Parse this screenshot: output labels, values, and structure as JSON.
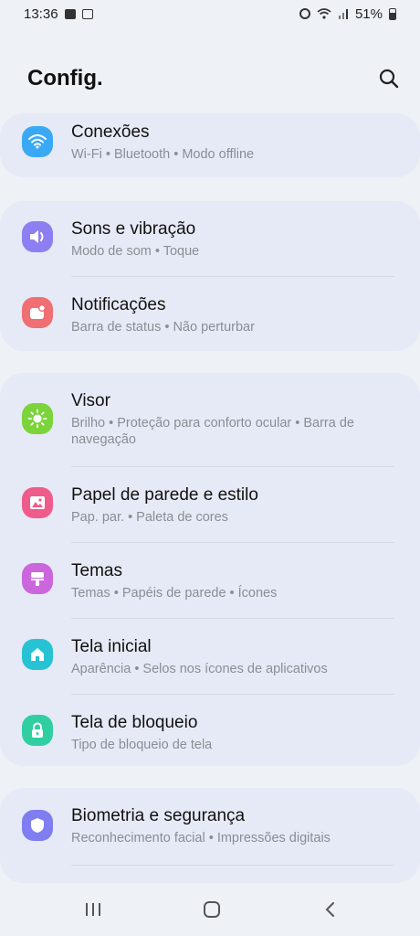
{
  "status_bar": {
    "time": "13:36",
    "battery_percent": "51%"
  },
  "header": {
    "title": "Config.",
    "search_icon": "search-icon"
  },
  "groups": [
    {
      "items": [
        {
          "id": "conexoes",
          "label": "Conexões",
          "subtitle": "Wi-Fi  •  Bluetooth  •  Modo offline",
          "icon": "wifi-icon",
          "color": "#3aa9f5"
        }
      ]
    },
    {
      "items": [
        {
          "id": "sons",
          "label": "Sons e vibração",
          "subtitle": "Modo de som  •  Toque",
          "icon": "speaker-icon",
          "color": "#8d7ff2"
        },
        {
          "id": "notificacoes",
          "label": "Notificações",
          "subtitle": "Barra de status  •  Não perturbar",
          "icon": "notification-icon",
          "color": "#ef6f73"
        }
      ]
    },
    {
      "items": [
        {
          "id": "visor",
          "label": "Visor",
          "subtitle": "Brilho  •  Proteção para conforto ocular  •  Barra de navegação",
          "icon": "sun-icon",
          "color": "#7ad43a"
        },
        {
          "id": "papel",
          "label": "Papel de parede e estilo",
          "subtitle": "Pap. par.  •  Paleta de cores",
          "icon": "image-icon",
          "color": "#ef5c8c"
        },
        {
          "id": "temas",
          "label": "Temas",
          "subtitle": "Temas  •  Papéis de parede  •  Ícones",
          "icon": "brush-icon",
          "color": "#cc66dd"
        },
        {
          "id": "tela-inicial",
          "label": "Tela inicial",
          "subtitle": "Aparência  •  Selos nos ícones de aplicativos",
          "icon": "home-icon",
          "color": "#27c2d4"
        },
        {
          "id": "tela-bloqueio",
          "label": "Tela de bloqueio",
          "subtitle": "Tipo de bloqueio de tela",
          "icon": "lock-icon",
          "color": "#2fcfa2"
        }
      ]
    },
    {
      "items": [
        {
          "id": "biometria",
          "label": "Biometria e segurança",
          "subtitle": "Reconhecimento facial  •  Impressões digitais",
          "icon": "shield-icon",
          "color": "#7f7df0"
        }
      ]
    }
  ],
  "nav_bar": {
    "recents_icon": "recents-icon",
    "home_icon": "home-button-icon",
    "back_icon": "back-icon"
  }
}
